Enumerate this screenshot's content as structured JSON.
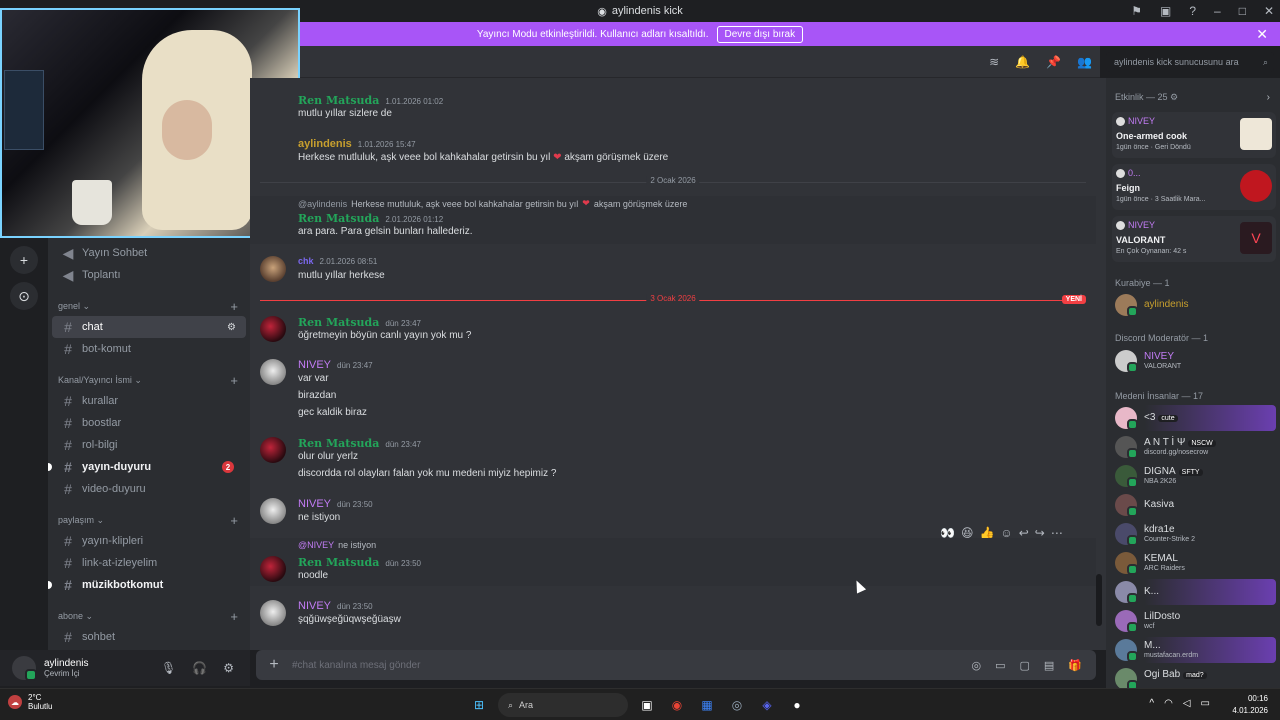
{
  "window": {
    "title": "aylindenis kick"
  },
  "banner": {
    "text": "Yayıncı Modu etkinleştirildi. Kullanıcı adları kısaltıldı.",
    "button": "Devre dışı bırak"
  },
  "search": {
    "placeholder": "aylindenis kick sunucusunu ara"
  },
  "channels": {
    "voice": [
      {
        "label": "Yayın Sohbet"
      },
      {
        "label": "Toplantı"
      }
    ],
    "cat_genel": "genel",
    "genel": [
      {
        "label": "chat"
      },
      {
        "label": "bot-komut"
      }
    ],
    "cat_kanal": "Kanal/Yayıncı İsmi",
    "kanal": [
      {
        "label": "kurallar"
      },
      {
        "label": "boostlar"
      },
      {
        "label": "rol-bilgi"
      },
      {
        "label": "yayın-duyuru",
        "badge": "2"
      },
      {
        "label": "video-duyuru"
      }
    ],
    "cat_paylasim": "paylaşım",
    "paylasim": [
      {
        "label": "yayın-klipleri"
      },
      {
        "label": "link-at-izleyelim"
      },
      {
        "label": "müzikbotkomut"
      }
    ],
    "cat_abone": "abone",
    "abone": [
      {
        "label": "sohbet"
      }
    ]
  },
  "user": {
    "name": "aylindenis",
    "status": "Çevrim İçi"
  },
  "messages": {
    "m1": {
      "author": "Ren Matsuda",
      "time": "1.01.2026 01:02",
      "text": "mutlu yıllar sizlere de"
    },
    "m2": {
      "author": "aylindenis",
      "time": "1.01.2026 15:47",
      "text_a": "Herkese mutluluk, aşk veee bol kahkahalar getirsin bu yıl",
      "text_b": "akşam görüşmek üzere"
    },
    "div1": "2 Ocak 2026",
    "m3": {
      "reply_mention": "@aylindenis",
      "reply_text_a": "Herkese mutluluk, aşk veee bol kahkahalar getirsin bu yıl",
      "reply_text_b": "akşam görüşmek üzere",
      "author": "Ren Matsuda",
      "time": "2.01.2026 01:12",
      "text": "ara para. Para gelsin bunları hallederiz."
    },
    "m4": {
      "author": "chk",
      "time": "2.01.2026 08:51",
      "text": "mutlu yıllar herkese"
    },
    "div2": "3 Ocak 2026",
    "div2_tag": "YENİ",
    "m5": {
      "author": "Ren Matsuda",
      "time": "dün 23:47",
      "text": "öğretmeyin böyün canlı yayın yok mu ?"
    },
    "m6": {
      "author": "NIVEY",
      "time": "dün 23:47",
      "l1": "var var",
      "l2": "birazdan",
      "l3": "gec kaldik biraz"
    },
    "m7": {
      "author": "Ren Matsuda",
      "time": "dün 23:47",
      "l1": "olur olur yerlz",
      "l2": "discordda rol olayları falan yok mu medeni miyiz hepimiz ?"
    },
    "m8": {
      "author": "NIVEY",
      "time": "dün 23:50",
      "text": "ne istiyon"
    },
    "m9": {
      "reply_mention": "@NIVEY",
      "reply_text": "ne istiyon",
      "author": "Ren Matsuda",
      "time": "dün 23:50",
      "text": "noodle"
    },
    "m10": {
      "author": "NIVEY",
      "time": "dün 23:50",
      "text": "şqğüwşeğüqwşeğüaşw"
    }
  },
  "reactions": {
    "r1": "👀",
    "r2": "😆",
    "r3": "👍"
  },
  "composer": {
    "placeholder": "#chat kanalına mesaj gönder"
  },
  "members": {
    "events": "Etkinlik — 25",
    "a1": {
      "who": "NIVEY",
      "what": "One-armed cook",
      "meta": "1gün önce · Geri Döndü"
    },
    "a2": {
      "who": "0...",
      "what": "Feign",
      "meta": "1gün önce · 3 Saatlik Mara..."
    },
    "a3": {
      "who": "NIVEY",
      "what": "VALORANT",
      "meta": "En Çok Oynanan: 42 s"
    },
    "kurabiye": "Kurabiye — 1",
    "k1": {
      "name": "aylindenis"
    },
    "mod": "Discord Moderatör — 1",
    "mod1": {
      "name": "NIVEY",
      "sub": "VALORANT"
    },
    "medeni": "Medeni İnsanlar — 17",
    "list": [
      {
        "name": "<3",
        "chip": "cute",
        "sub": ""
      },
      {
        "name": "A N T İ Ψ",
        "chip": "NSCW",
        "sub": "discord.gg/nosecrow"
      },
      {
        "name": "DIGNA",
        "chip": "SFTY",
        "sub": "NBA 2K26"
      },
      {
        "name": "Kasiva",
        "chip": "",
        "sub": ""
      },
      {
        "name": "kdra1e",
        "chip": "",
        "sub": "Counter-Strike 2"
      },
      {
        "name": "KEMAL",
        "chip": "",
        "sub": "ARC Raiders"
      },
      {
        "name": "K...",
        "chip": "",
        "sub": ""
      },
      {
        "name": "LilDosto",
        "chip": "",
        "sub": "wcf"
      },
      {
        "name": "M...",
        "chip": "",
        "sub": "mustafacan.erdm"
      },
      {
        "name": "Ogi Bab",
        "chip": "mad?",
        "sub": ""
      }
    ]
  },
  "taskbar": {
    "temp": "2°C",
    "weather": "Bulutlu",
    "search": "Ara",
    "time": "00:16",
    "date": "4.01.2026"
  }
}
